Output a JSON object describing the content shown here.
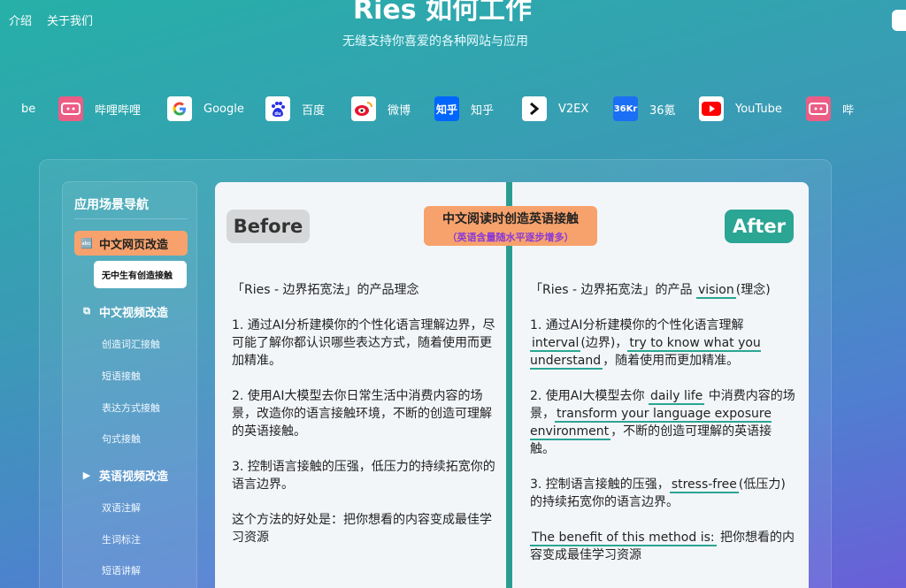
{
  "nav": {
    "intro": "介绍",
    "about": "关于我们"
  },
  "hero": {
    "title": "Ries 如何工作",
    "subtitle": "无缝支持你喜爱的各种网站与应用"
  },
  "sites": [
    {
      "label": "be",
      "icon": "youtube-icon"
    },
    {
      "label": "哔哩哔哩",
      "icon": "bilibili-icon"
    },
    {
      "label": "Google",
      "icon": "google-icon"
    },
    {
      "label": "百度",
      "icon": "baidu-icon"
    },
    {
      "label": "微博",
      "icon": "weibo-icon"
    },
    {
      "label": "知乎",
      "icon": "zhihu-icon"
    },
    {
      "label": "V2EX",
      "icon": "v2ex-icon"
    },
    {
      "label": "36氪",
      "icon": "36kr-icon"
    },
    {
      "label": "YouTube",
      "icon": "youtube-icon"
    },
    {
      "label": "哔",
      "icon": "bilibili-icon"
    }
  ],
  "sidebar": {
    "title": "应用场景导航",
    "cat1": "中文网页改造",
    "cat1_sub1": "无中生有创造接触",
    "cat2": "中文视频改造",
    "cat2_sub1": "创造词汇接触",
    "cat2_sub2": "短语接触",
    "cat2_sub3": "表达方式接触",
    "cat2_sub4": "句式接触",
    "cat3": "英语视频改造",
    "cat3_sub1": "双语注解",
    "cat3_sub2": "生词标注",
    "cat3_sub3": "短语讲解"
  },
  "compare": {
    "before": "Before",
    "after": "After",
    "label_main": "中文阅读时创造英语接触",
    "label_sub": "（英语含量随水平逐步增多）",
    "left": {
      "p0": "「Ries - 边界拓宽法」的产品理念",
      "p1": "1. 通过AI分析建模你的个性化语言理解边界，尽可能了解你都认识哪些表达方式，随着使用而更加精准。",
      "p2": "2. 使用AI大模型去你日常生活中消费内容的场景，改造你的语言接触环境，不断的创造可理解的英语接触。",
      "p3": "3. 控制语言接触的压强，低压力的持续拓宽你的语言边界。",
      "p4": "这个方法的好处是：把你想看的内容变成最佳学习资源"
    },
    "right": {
      "p0a": "「Ries - 边界拓宽法」的产品",
      "p0_en": "vision",
      "p0b": "(理念)",
      "p1a": "1. 通过AI分析建模你的个性化语言理解",
      "p1_en1": "interval",
      "p1b": "(边界)，",
      "p1_en2": "try to know what you understand",
      "p1c": "，随着使用而更加精准。",
      "p2a": "2. 使用AI大模型去你",
      "p2_en1": "daily life",
      "p2b": "中消费内容的场景，",
      "p2_en2": "transform your language exposure environment",
      "p2c": "，不断的创造可理解的英语接触。",
      "p3a": "3. 控制语言接触的压强，",
      "p3_en": "stress-free",
      "p3b": "(低压力) 的持续拓宽你的语言边界。",
      "p4_en": "The benefit of this method is:",
      "p4b": "把你想看的内容变成最佳学习资源"
    }
  },
  "colors": {
    "accent_teal": "#2ba594",
    "accent_orange": "#f7a26c",
    "label_purple": "#8a3ad6"
  }
}
